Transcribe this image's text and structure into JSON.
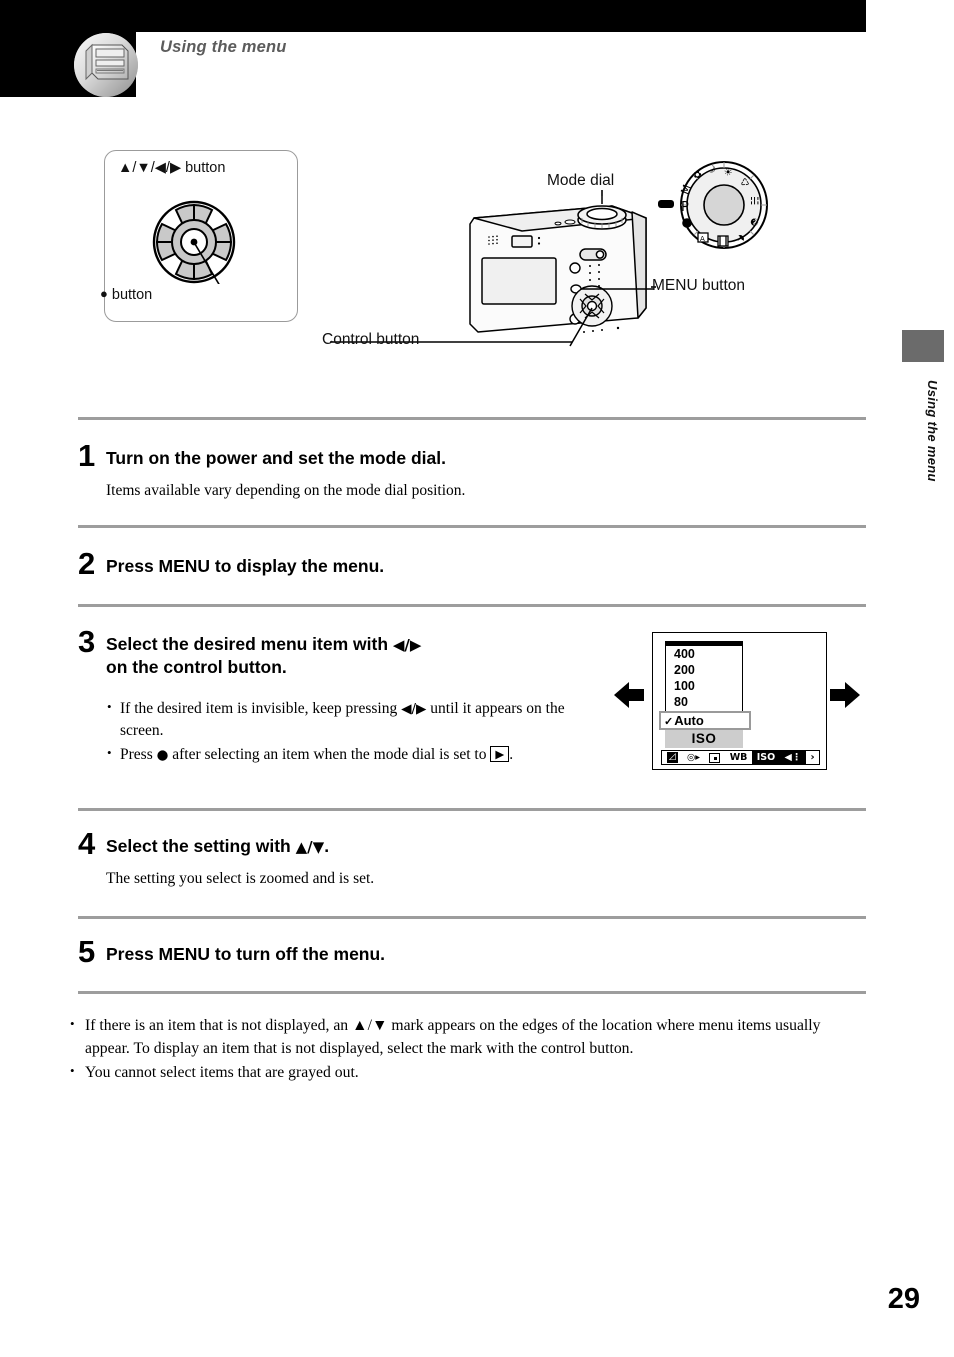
{
  "header": {
    "title": "Using the menu",
    "icon": "lcd-screen-icon"
  },
  "figure": {
    "control_box": {
      "direction_button_label": "▲/▼/◀/▶ button",
      "center_button_label": "button",
      "center_button_glyph": "●"
    },
    "callouts": {
      "mode_dial": "Mode dial",
      "menu_button": "MENU button",
      "control_button": "Control button"
    },
    "mode_dial_positions": [
      "M",
      "P",
      "●",
      "A",
      "▤",
      "☀",
      "☾",
      "❀",
      "⌂",
      "↯"
    ]
  },
  "side_tab": {
    "label": "Using the menu"
  },
  "steps": [
    {
      "number": "1",
      "title": "Turn on the power and set the mode dial.",
      "body": "Items available vary depending on the mode dial position."
    },
    {
      "number": "2",
      "title": "Press MENU to display the menu.",
      "body": ""
    },
    {
      "number": "3",
      "title_part1": "Select the desired menu item with ",
      "title_keys": "◀/▶",
      "title_part2": "on the control button.",
      "bullets": [
        {
          "pre": "If the desired item is invisible, keep pressing ",
          "keys": "◀/▶",
          "post": " until it appears on the screen."
        },
        {
          "pre": "Press ",
          "keys": "●",
          "mid": " after selecting an item when the mode dial is set to ",
          "boxkey": "▶",
          "post": "."
        }
      ]
    },
    {
      "number": "4",
      "title_part1": "Select the setting with ",
      "title_keys": "▲/▼",
      "title_part2": ".",
      "body": "The setting you select is zoomed and is set."
    },
    {
      "number": "5",
      "title": "Press MENU to turn off the menu.",
      "body": ""
    }
  ],
  "lcd": {
    "list_items": [
      "400",
      "200",
      "100",
      "80"
    ],
    "selected_item": "Auto",
    "selected_check": "✓",
    "category_label": "ISO",
    "menu_bar": [
      {
        "icon": "ev-compensation-icon",
        "text": "⬌",
        "inverted": false
      },
      {
        "icon": "focus-icon",
        "text": "◎▸",
        "inverted": false
      },
      {
        "icon": "metering-spot-icon",
        "text": "sq",
        "inverted": false
      },
      {
        "icon": "white-balance-icon",
        "text": "WB",
        "inverted": false
      },
      {
        "icon": "iso-icon",
        "text": "ISO",
        "inverted": true
      },
      {
        "icon": "flash-level-icon",
        "text": "◀··",
        "inverted": true
      },
      {
        "icon": "more-arrow-icon",
        "text": "›",
        "inverted": false
      }
    ],
    "left_arrow": "◀",
    "right_arrow": "▶"
  },
  "notes": [
    "If there is an item that is not displayed, an ▲/▼ mark appears on the edges of the location where menu items usually appear. To display an item that is not displayed, select the mark with the control button.",
    "You cannot select items that are grayed out."
  ],
  "page_number": "29"
}
